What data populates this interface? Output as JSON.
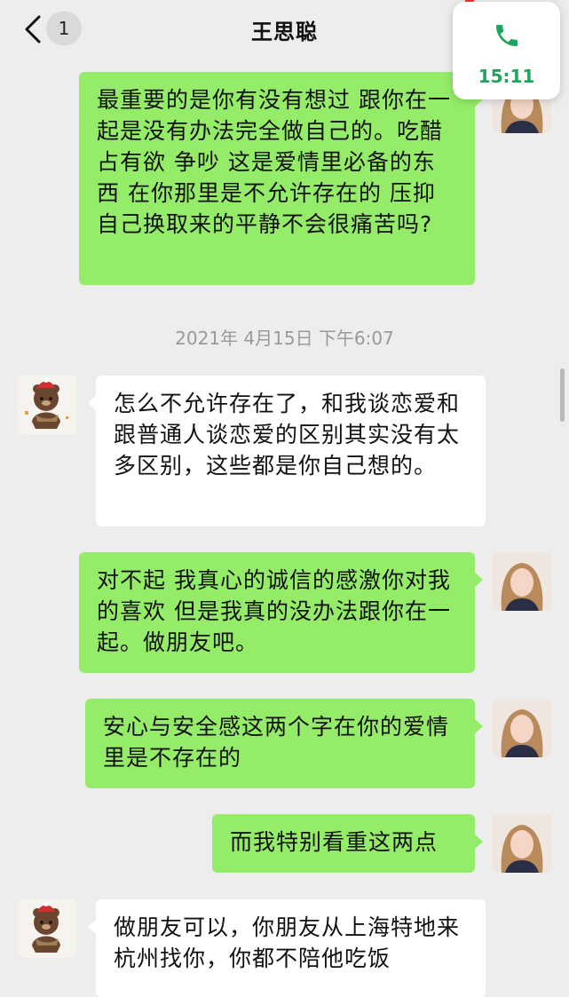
{
  "header": {
    "title": "王思聪",
    "unread_count": "1"
  },
  "call_widget": {
    "duration": "15:11",
    "icon": "phone-icon"
  },
  "timestamp": "2021年 4月15日 下午6:07",
  "messages": [
    {
      "from": "me",
      "text": "最重要的是你有没有想过 跟你在一起是没有办法完全做自己的。吃醋 占有欲 争吵 这是爱情里必备的东西 在你那里是不允许存在的 压抑自己换取来的平静不会很痛苦吗?"
    },
    {
      "from": "other",
      "text": "怎么不允许存在了，和我谈恋爱和跟普通人谈恋爱的区别其实没有太多区别，这些都是你自己想的。"
    },
    {
      "from": "me",
      "text": "对不起 我真心的诚信的感激你对我的喜欢 但是我真的没办法跟你在一起。做朋友吧。"
    },
    {
      "from": "me",
      "text": "安心与安全感这两个字在你的爱情里是不存在的"
    },
    {
      "from": "me",
      "text": "而我特别看重这两点"
    },
    {
      "from": "other",
      "text": "做朋友可以，你朋友从上海特地来杭州找你，你都不陪他吃饭"
    }
  ],
  "colors": {
    "background": "#ededed",
    "my_bubble": "#95ec69",
    "other_bubble": "#ffffff",
    "call_green": "#1ea55d"
  }
}
